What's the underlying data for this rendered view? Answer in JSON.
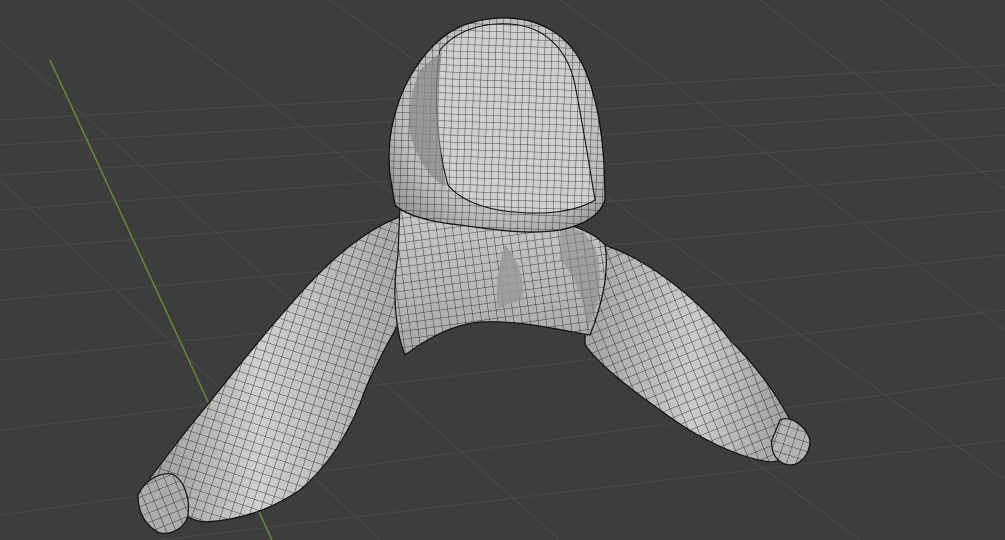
{
  "viewport": {
    "view": "3D Viewport",
    "shading": "solid-wireframe-overlay",
    "colors": {
      "background": "#3d3d3d",
      "grid_line": "#494949",
      "y_axis": "#6e8a33",
      "mesh_fill": "#bdbdbd",
      "mesh_light": "#d8d8d8",
      "mesh_shadow": "#7f7f7f",
      "wire": "#1b1b1b"
    },
    "mesh": {
      "object": "hoodie",
      "parts": [
        "hood",
        "hood-opening",
        "torso-front",
        "left-sleeve",
        "right-sleeve",
        "left-cuff",
        "right-cuff",
        "neck-fold"
      ]
    }
  }
}
